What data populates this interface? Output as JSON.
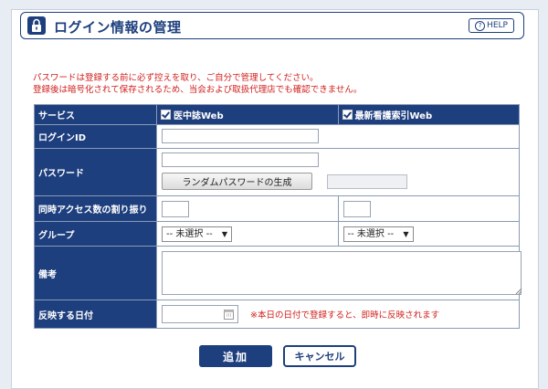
{
  "header": {
    "title": "ログイン情報の管理",
    "help_label": "HELP",
    "help_icon": "question-circle-icon"
  },
  "notice": {
    "line1": "パスワードは登録する前に必ず控えを取り、ご自分で管理してください。",
    "line2": "登録後は暗号化されて保存されるため、当会および取扱代理店でも確認できません。"
  },
  "form": {
    "service_label": "サービス",
    "service_1": "医中誌Web",
    "service_2": "最新看護索引Web",
    "login_id_label": "ログインID",
    "login_id_value": "",
    "password_label": "パスワード",
    "password_value": "",
    "generate_button": "ランダムパスワードの生成",
    "generated_value": "",
    "concurrent_label": "同時アクセス数の割り振り",
    "concurrent_1": "",
    "concurrent_2": "",
    "group_label": "グループ",
    "group_1": "-- 未選択 --",
    "group_2": "-- 未選択 --",
    "remarks_label": "備考",
    "remarks_value": "",
    "date_label": "反映する日付",
    "date_value": "",
    "date_note": "※本日の日付で登録すると、即時に反映されます"
  },
  "actions": {
    "add_label": "追加",
    "cancel_label": "キャンセル"
  },
  "colors": {
    "brand": "#1e3f7e",
    "notice": "#d0201c"
  }
}
